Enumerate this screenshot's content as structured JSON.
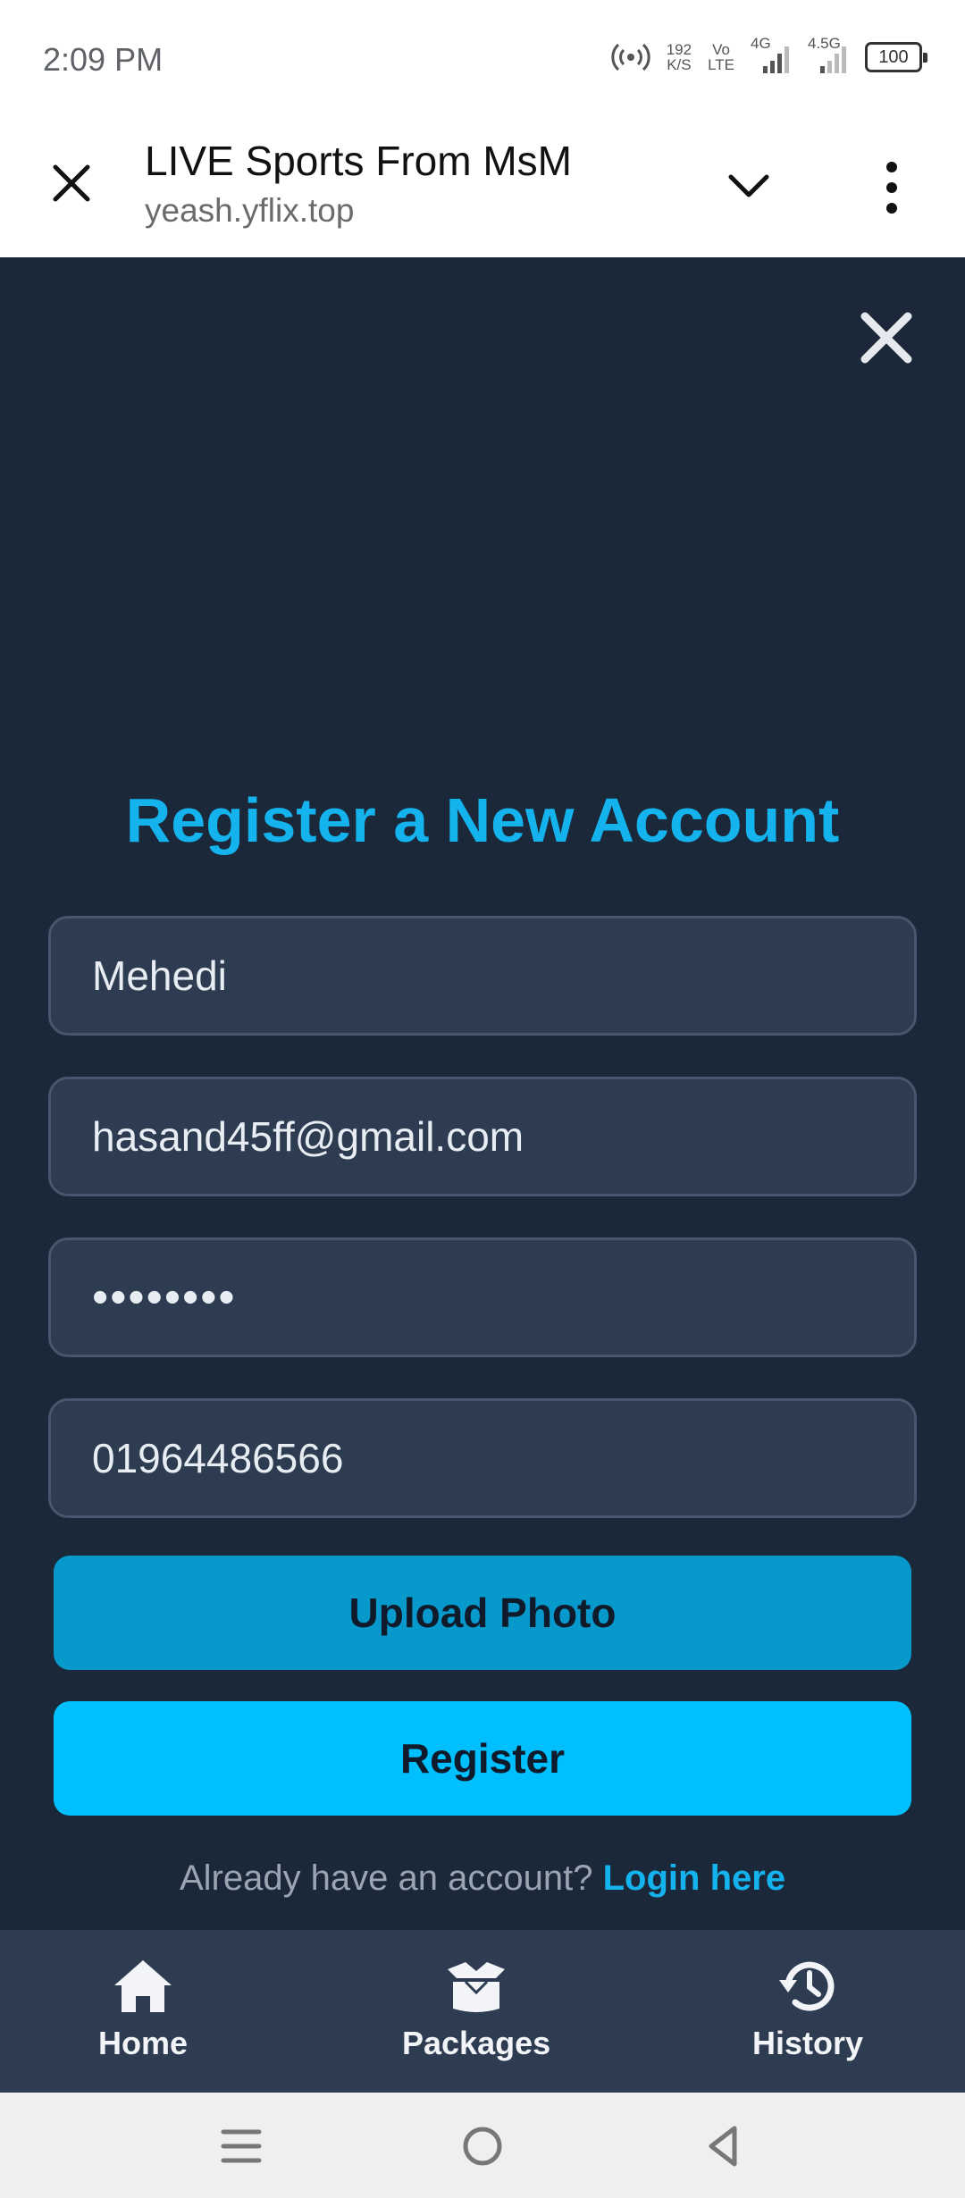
{
  "status_bar": {
    "time": "2:09 PM",
    "net_speed_value": "192",
    "net_speed_unit": "K/S",
    "volte_top": "Vo",
    "volte_bottom": "LTE",
    "sim1_label": "4G",
    "sim2_label": "4.5G",
    "battery": "100",
    "icons": [
      "hotspot-icon",
      "signal-icon",
      "signal-icon",
      "battery-icon"
    ]
  },
  "tab_header": {
    "title": "LIVE Sports From MsM",
    "url": "yeash.yflix.top",
    "icons": [
      "close-icon",
      "chevron-down-icon",
      "more-vertical-icon"
    ]
  },
  "form": {
    "title": "Register a New Account",
    "name_value": "Mehedi",
    "email_value": "hasand45ff@gmail.com",
    "password_value": "••••••••",
    "phone_value": "01964486566",
    "upload_label": "Upload Photo",
    "register_label": "Register",
    "login_prompt": "Already have an account?",
    "login_link": "Login here"
  },
  "bottom_nav": {
    "items": [
      {
        "label": "Home",
        "icon": "home-icon"
      },
      {
        "label": "Packages",
        "icon": "box-icon"
      },
      {
        "label": "History",
        "icon": "history-icon"
      }
    ]
  },
  "system_nav": {
    "icons": [
      "menu-icon",
      "home-circle-icon",
      "back-icon"
    ]
  },
  "colors": {
    "background": "#1b2839",
    "accent": "#14b3ee",
    "register_button": "#00bfff",
    "upload_button": "#0899cc",
    "field": "#2e3c51"
  }
}
